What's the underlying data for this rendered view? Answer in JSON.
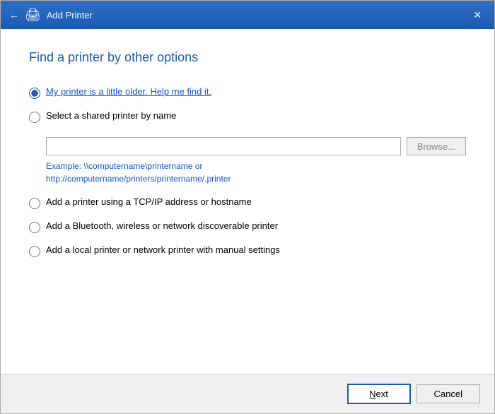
{
  "window": {
    "title": "Add Printer",
    "close_label": "✕",
    "back_label": "←"
  },
  "page": {
    "title": "Find a printer by other options"
  },
  "options": [
    {
      "id": "opt1",
      "label": "My printer is a little older. Help me find it.",
      "checked": true,
      "link_style": true
    },
    {
      "id": "opt2",
      "label": "Select a shared printer by name",
      "checked": false,
      "link_style": false
    },
    {
      "id": "opt3",
      "label": "Add a printer using a TCP/IP address or hostname",
      "checked": false,
      "link_style": false
    },
    {
      "id": "opt4",
      "label": "Add a Bluetooth, wireless or network discoverable printer",
      "checked": false,
      "link_style": false
    },
    {
      "id": "opt5",
      "label": "Add a local printer or network printer with manual settings",
      "checked": false,
      "link_style": false
    }
  ],
  "shared_printer": {
    "placeholder": "",
    "browse_label": "Browse...",
    "example_line1": "Example: \\\\computername\\printername or",
    "example_line2": "http://computername/printers/printername/.printer"
  },
  "footer": {
    "next_label": "Next",
    "cancel_label": "Cancel"
  },
  "icons": {
    "printer": "🖨"
  }
}
